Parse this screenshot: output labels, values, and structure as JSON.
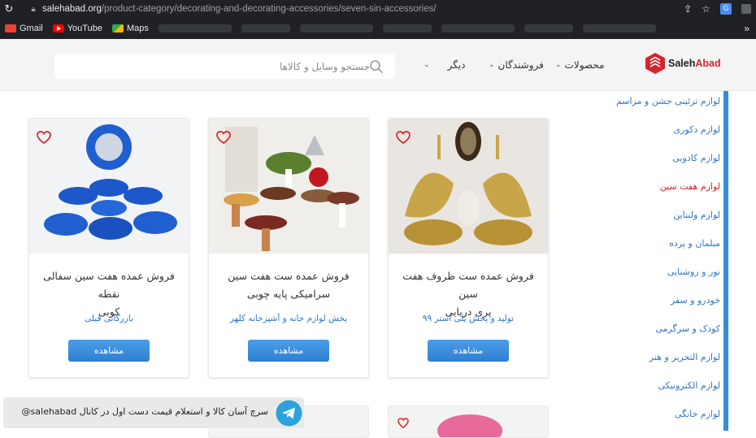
{
  "browser": {
    "url_host": "salehabad.org",
    "url_path": "/product-category/decorating-and-decorating-accessories/seven-sin-accessories/",
    "bookmarks": [
      "Gmail",
      "YouTube",
      "Maps"
    ]
  },
  "header": {
    "logo_text_a": "Saleh",
    "logo_text_b": "Abad",
    "nav_products": "محصولات",
    "nav_sellers": "فروشندگان",
    "nav_other": "دیگر",
    "search_placeholder": "جستجو وسایل و کالاها"
  },
  "sidebar": {
    "items": [
      {
        "label": "لوازم تزئینی جشن و مراسم",
        "active": false
      },
      {
        "label": "لوازم دکوری",
        "active": false
      },
      {
        "label": "لوازم کادویی",
        "active": false
      },
      {
        "label": "لوازم هفت سین",
        "active": true
      },
      {
        "label": "لوازم ولنتاین",
        "active": false
      },
      {
        "label": "مبلمان و پرده",
        "active": false
      },
      {
        "label": "نور و روشنایی",
        "active": false
      },
      {
        "label": "خودرو و سفر",
        "active": false
      },
      {
        "label": "کودک و سرگرمی",
        "active": false
      },
      {
        "label": "لوازم التحریر و هنر",
        "active": false
      },
      {
        "label": "لوازم الکترونیکی",
        "active": false
      },
      {
        "label": "لوازم خانگی",
        "active": false
      }
    ]
  },
  "products": [
    {
      "title_l1": "فروش عمده ست ظروف هفت سین",
      "title_l2": "پری دریایی",
      "seller": "تولید و پخش پلی استر ۹۹",
      "button": "مشاهده"
    },
    {
      "title_l1": "فروش عمده ست هفت سین",
      "title_l2": "سرامیکی پایه چوبی",
      "seller": "پخش لوازم خانه و آشپزخانه کلهر",
      "button": "مشاهده"
    },
    {
      "title_l1": "فروش عمده هفت سین سفالی نقطه",
      "title_l2": "کوبی",
      "seller": "بازرگانی فیلی",
      "button": "مشاهده"
    }
  ],
  "telegram_banner": "سرچ آسان کالا و استعلام قیمت دست اول در کانال salehabad@",
  "colors": {
    "accent": "#2f8fd9",
    "brand": "#d8232a",
    "link": "#2f77c6"
  }
}
